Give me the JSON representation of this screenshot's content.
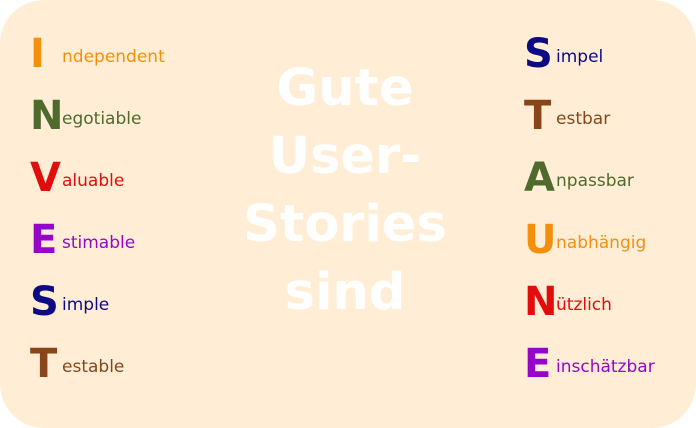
{
  "center_lines": [
    "Gute",
    "User-",
    "Stories",
    "sind"
  ],
  "invest": [
    {
      "letter": "I",
      "rest": "ndependent",
      "color": "#f2900d"
    },
    {
      "letter": "N",
      "rest": "egotiable",
      "color": "#4f6a2c"
    },
    {
      "letter": "V",
      "rest": "aluable",
      "color": "#e20c0c"
    },
    {
      "letter": "E",
      "rest": "stimable",
      "color": "#9407c9"
    },
    {
      "letter": "S",
      "rest": "imple",
      "color": "#0d0b83"
    },
    {
      "letter": "T",
      "rest": "estable",
      "color": "#86461a"
    }
  ],
  "staune": [
    {
      "letter": "S",
      "rest": "impel",
      "color": "#0d0b83"
    },
    {
      "letter": "T",
      "rest": "estbar",
      "color": "#86461a"
    },
    {
      "letter": "A",
      "rest": "npassbar",
      "color": "#4f6a2c"
    },
    {
      "letter": "U",
      "rest": "nabhängig",
      "color": "#f2900d"
    },
    {
      "letter": "N",
      "rest": "ützlich",
      "color": "#e20c0c"
    },
    {
      "letter": "E",
      "rest": "inschätzbar",
      "color": "#9407c9"
    }
  ]
}
